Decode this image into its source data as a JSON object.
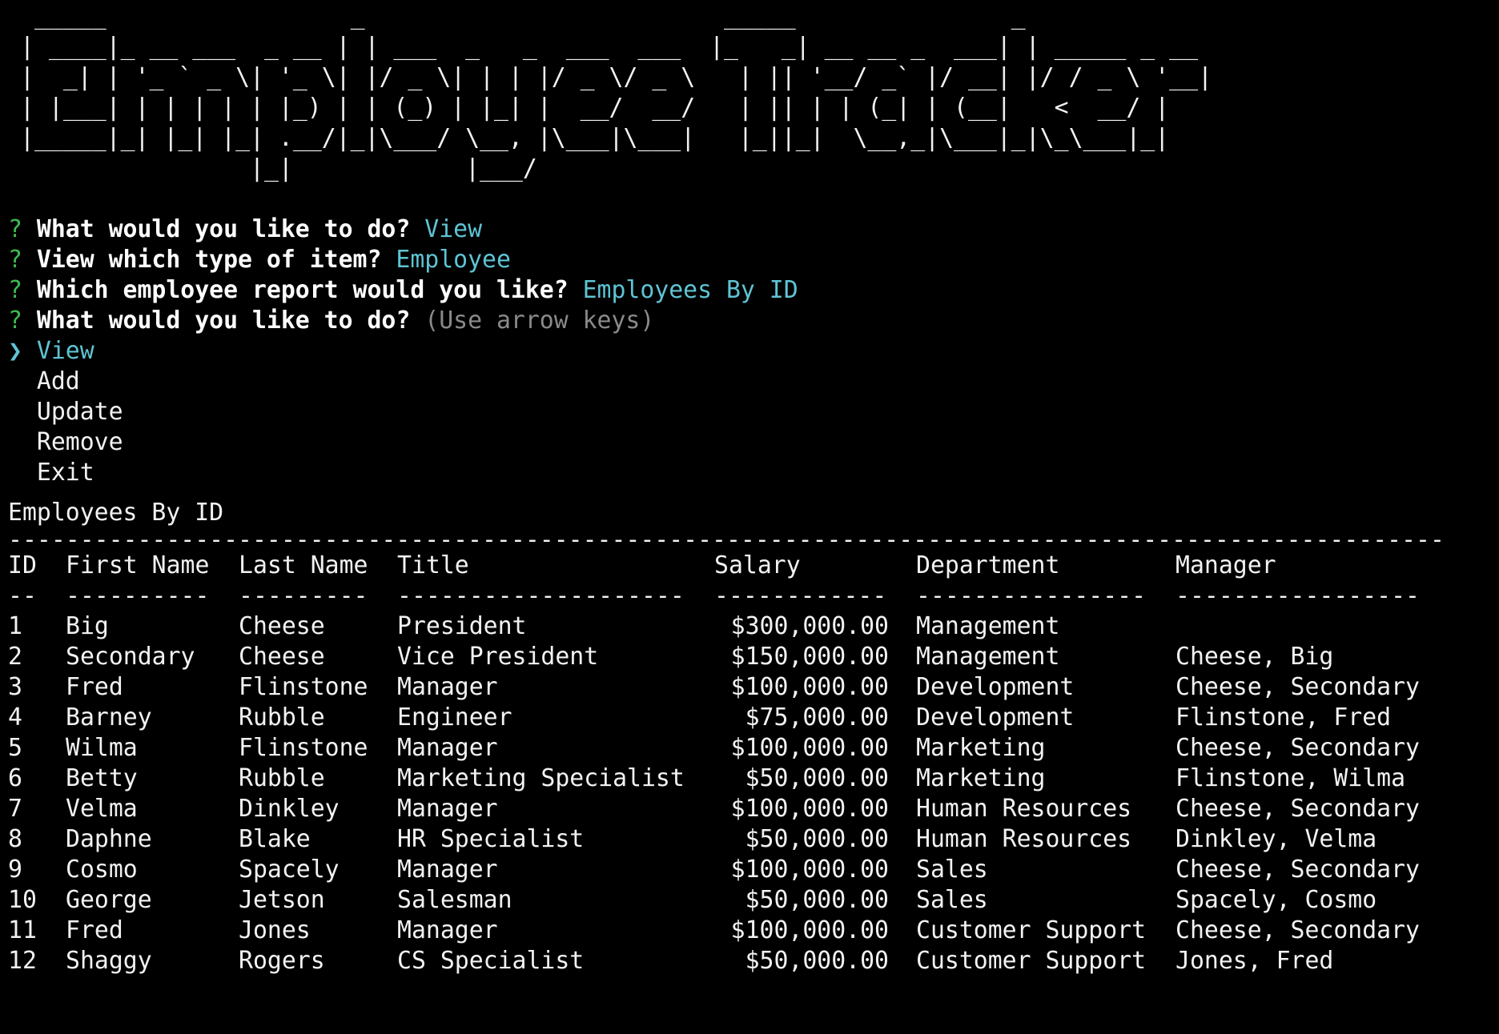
{
  "terminal": {
    "background": "#000000",
    "foreground": "#f2f2f2",
    "accent": "#5ec4d4",
    "prompt_mark_color": "#3fb950",
    "hint_color": "#8a8a8a"
  },
  "banner": {
    "lines": [
      " _____                 _                         _____               _",
      "| ____|_ __ ___  _ __ | | ___  _   _  ___  ___  |_   _| __ __ _  ___| | _____ _ __",
      "|  _| | '_ ` _ \\| '_ \\| |/ _ \\| | | |/ _ \\/ _ \\   | || '__/ _` |/ __| |/ / _ \\ '__|",
      "| |___| | | | | | |_) | | (_) | |_| |  __/  __/   | || | | (_| | (__|   <  __/ |",
      "|_____|_| |_| |_| .__/|_|\\___/ \\__, |\\___|\\___|   |_||_|  \\__,_|\\___|_|\\_\\___|_|",
      "                |_|            |___/"
    ]
  },
  "prompts": [
    {
      "mark": "?",
      "question": "What would you like to do?",
      "answer": "View"
    },
    {
      "mark": "?",
      "question": "View which type of item?",
      "answer": "Employee"
    },
    {
      "mark": "?",
      "question": "Which employee report would you like?",
      "answer": "Employees By ID"
    },
    {
      "mark": "?",
      "question": "What would you like to do?",
      "hint": "(Use arrow keys)"
    }
  ],
  "menu": {
    "pointer": "❯",
    "options": [
      "View",
      "Add",
      "Update",
      "Remove",
      "Exit"
    ],
    "selected": "View"
  },
  "report": {
    "title": "Employees By ID",
    "rule": "----------------------------------------------------------------------------------------------------",
    "headers": [
      "ID",
      "First Name",
      "Last Name",
      "Title",
      "Salary",
      "Department",
      "Manager"
    ],
    "underlines": [
      "--",
      "----------",
      "---------",
      "--------------------",
      "------------",
      "----------------",
      "-----------------"
    ],
    "rows": [
      [
        "1",
        "Big",
        "Cheese",
        "President",
        "$300,000.00",
        "Management",
        ""
      ],
      [
        "2",
        "Secondary",
        "Cheese",
        "Vice President",
        "$150,000.00",
        "Management",
        "Cheese, Big"
      ],
      [
        "3",
        "Fred",
        "Flinstone",
        "Manager",
        "$100,000.00",
        "Development",
        "Cheese, Secondary"
      ],
      [
        "4",
        "Barney",
        "Rubble",
        "Engineer",
        "$75,000.00",
        "Development",
        "Flinstone, Fred"
      ],
      [
        "5",
        "Wilma",
        "Flinstone",
        "Manager",
        "$100,000.00",
        "Marketing",
        "Cheese, Secondary"
      ],
      [
        "6",
        "Betty",
        "Rubble",
        "Marketing Specialist",
        "$50,000.00",
        "Marketing",
        "Flinstone, Wilma"
      ],
      [
        "7",
        "Velma",
        "Dinkley",
        "Manager",
        "$100,000.00",
        "Human Resources",
        "Cheese, Secondary"
      ],
      [
        "8",
        "Daphne",
        "Blake",
        "HR Specialist",
        "$50,000.00",
        "Human Resources",
        "Dinkley, Velma"
      ],
      [
        "9",
        "Cosmo",
        "Spacely",
        "Manager",
        "$100,000.00",
        "Sales",
        "Cheese, Secondary"
      ],
      [
        "10",
        "George",
        "Jetson",
        "Salesman",
        "$50,000.00",
        "Sales",
        "Spacely, Cosmo"
      ],
      [
        "11",
        "Fred",
        "Jones",
        "Manager",
        "$100,000.00",
        "Customer Support",
        "Cheese, Secondary"
      ],
      [
        "12",
        "Shaggy",
        "Rogers",
        "CS Specialist",
        "$50,000.00",
        "Customer Support",
        "Jones, Fred"
      ]
    ]
  }
}
